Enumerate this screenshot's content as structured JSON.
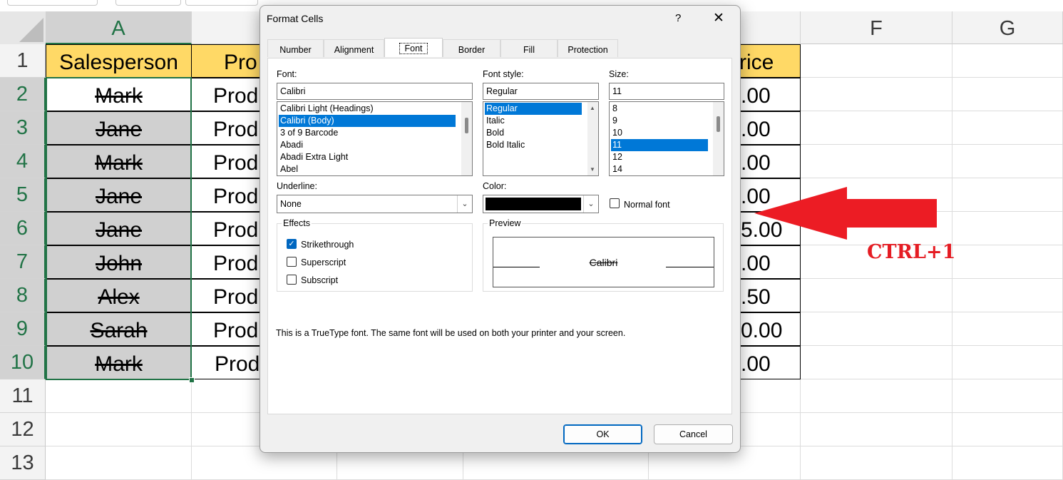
{
  "sheet": {
    "columns": [
      "A",
      "F",
      "G"
    ],
    "rows": [
      "1",
      "2",
      "3",
      "4",
      "5",
      "6",
      "7",
      "8",
      "9",
      "10",
      "11",
      "12",
      "13"
    ],
    "header_row": {
      "salesperson": "Salesperson",
      "product": "Pro",
      "price": "rice"
    },
    "names": [
      "Mark",
      "Jane",
      "Mark",
      "Jane",
      "Jane",
      "John",
      "Alex",
      "Sarah",
      "Mark"
    ],
    "products": [
      "Prod",
      "Prod",
      "Prod",
      "Prod",
      "Prod",
      "Prod",
      "Prod",
      "Prod",
      "Prod"
    ],
    "prices": [
      ".00",
      ".00",
      ".00",
      ".00",
      "5.00",
      ".00",
      ".50",
      "0.00",
      ".00"
    ]
  },
  "annotation": {
    "text": "CTRL+1",
    "color": "#e51c23"
  },
  "dialog": {
    "title": "Format Cells",
    "help": "?",
    "close": "✕",
    "tabs": [
      "Number",
      "Alignment",
      "Font",
      "Border",
      "Fill",
      "Protection"
    ],
    "active_tab": "Font",
    "font": {
      "label": "Font:",
      "value": "Calibri",
      "list": [
        "Calibri Light (Headings)",
        "Calibri (Body)",
        "3 of 9 Barcode",
        "Abadi",
        "Abadi Extra Light",
        "Abel"
      ],
      "selected": "Calibri (Body)"
    },
    "style": {
      "label": "Font style:",
      "value": "Regular",
      "list": [
        "Regular",
        "Italic",
        "Bold",
        "Bold Italic"
      ],
      "selected": "Regular"
    },
    "size": {
      "label": "Size:",
      "value": "11",
      "list": [
        "8",
        "9",
        "10",
        "11",
        "12",
        "14"
      ],
      "selected": "11"
    },
    "underline": {
      "label": "Underline:",
      "value": "None"
    },
    "color": {
      "label": "Color:",
      "swatch": "#000000"
    },
    "normal_font": {
      "label": "Normal font",
      "checked": false
    },
    "effects": {
      "label": "Effects",
      "strikethrough": {
        "label": "Strikethrough",
        "checked": true
      },
      "superscript": {
        "label": "Superscript",
        "checked": false
      },
      "subscript": {
        "label": "Subscript",
        "checked": false
      }
    },
    "preview": {
      "label": "Preview",
      "sample": "Calibri"
    },
    "info": "This is a TrueType font.  The same font will be used on both your printer and your screen.",
    "ok": "OK",
    "cancel": "Cancel"
  }
}
